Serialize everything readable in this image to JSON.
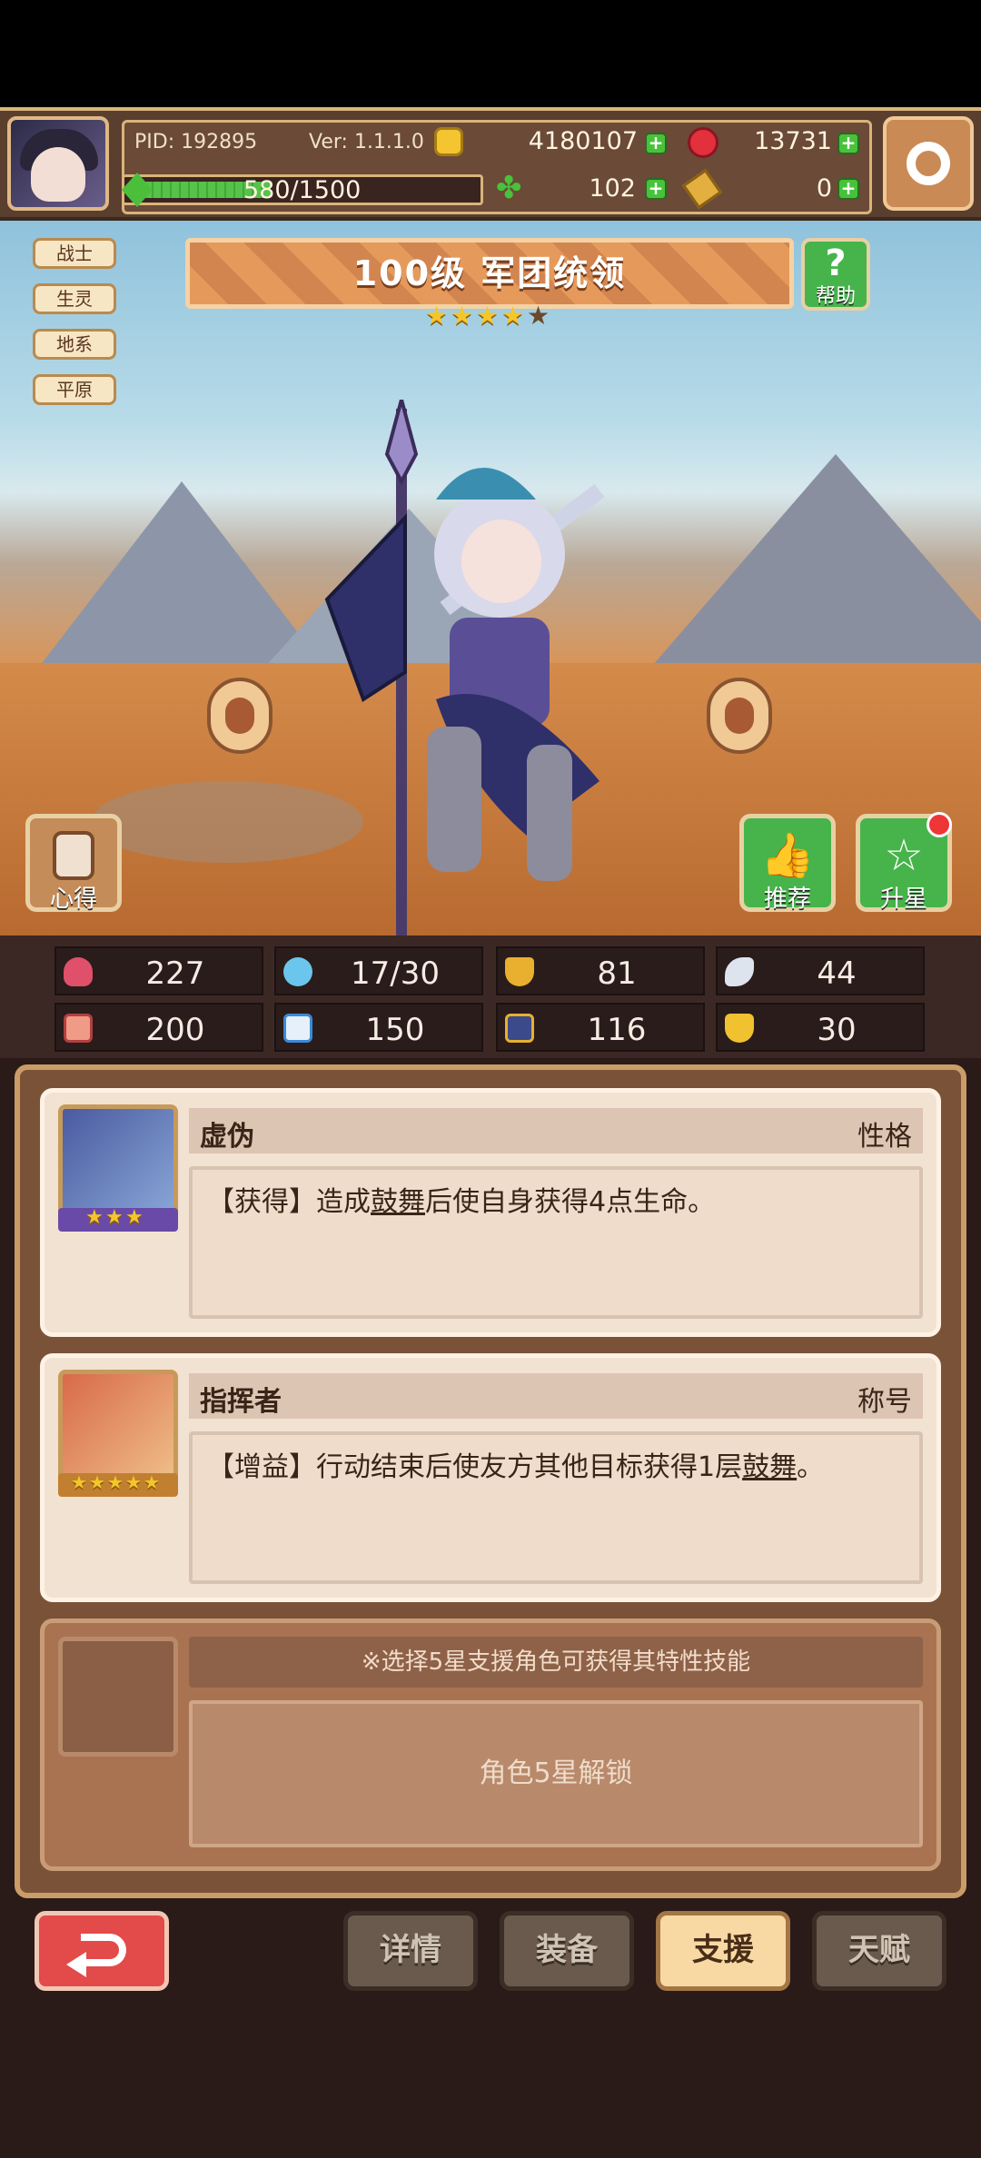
{
  "header": {
    "pid": "PID: 192895",
    "version": "Ver: 1.1.1.0",
    "gold": "4180107",
    "gems": "13731",
    "energy": "580/1500",
    "energy_fraction": 0.387,
    "clover": "102",
    "tickets": "0"
  },
  "hero": {
    "title": "100级  军团统领",
    "stars": 4,
    "stars_max": 5,
    "tags": [
      "战士",
      "生灵",
      "地系",
      "平原"
    ],
    "help_label": "帮助",
    "insight_label": "心得",
    "recommend_label": "推荐",
    "upgrade_label": "升星"
  },
  "stats": {
    "hp": "227",
    "mana": "17/30",
    "defense": "81",
    "speed": "44",
    "attack": "200",
    "magic": "150",
    "crit": "116",
    "luck": "30"
  },
  "support": {
    "card1": {
      "name": "虚伪",
      "tag": "性格",
      "desc_prefix": "【获得】造成",
      "desc_keyword": "鼓舞",
      "desc_suffix": "后使自身获得4点生命。",
      "stars": 3
    },
    "card2": {
      "name": "指挥者",
      "tag": "称号",
      "desc_prefix": "【增益】行动结束后使友方其他目标获得1层",
      "desc_keyword": "鼓舞",
      "desc_suffix": "。",
      "stars": 5
    },
    "card3": {
      "hint": "※选择5星支援角色可获得其特性技能",
      "locked": "角色5星解锁"
    }
  },
  "nav": {
    "details": "详情",
    "equipment": "装备",
    "support": "支援",
    "talent": "天赋"
  },
  "colors": {
    "accent_gold": "#f5c62a",
    "green": "#46b44a",
    "red_back": "#e34a4a",
    "active_tab": "#f8d9a4"
  }
}
